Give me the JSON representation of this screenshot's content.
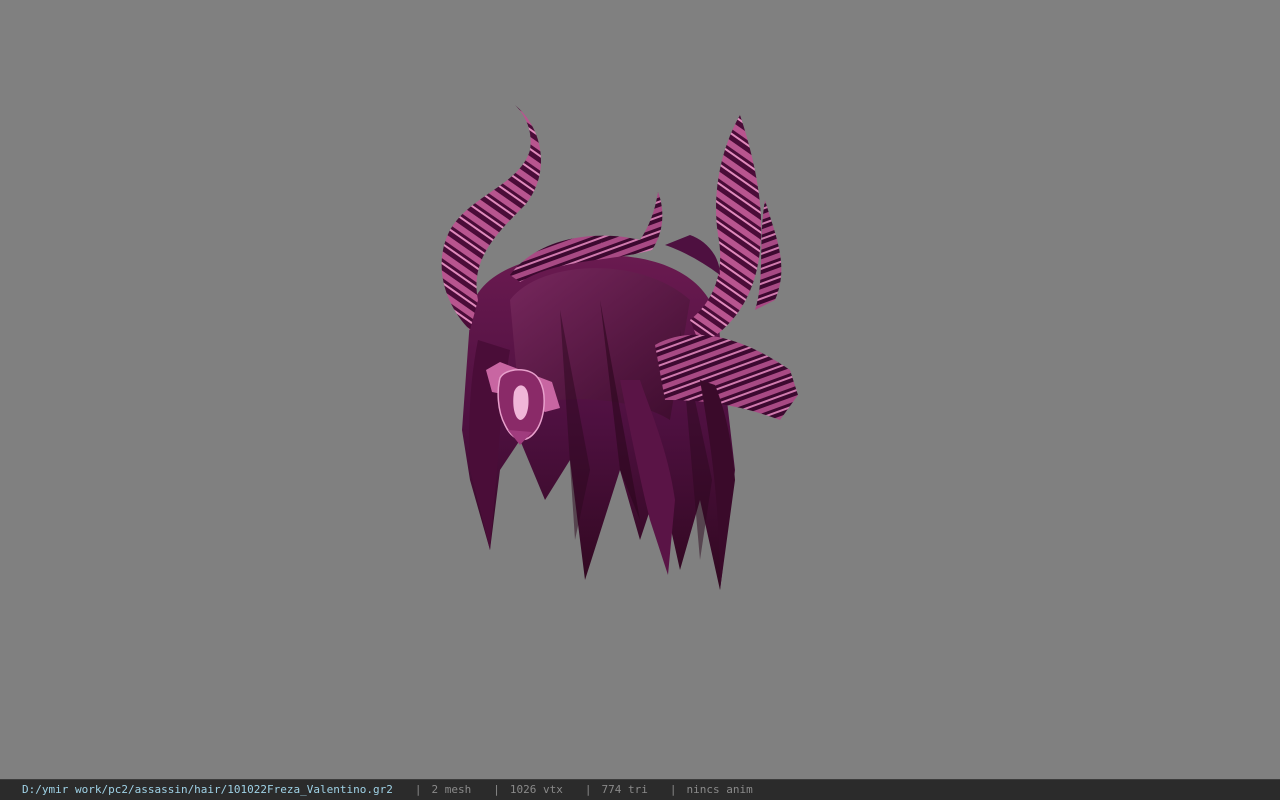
{
  "viewer": {
    "background_color": "#808080",
    "model": {
      "icon": "horned-hair-model",
      "colors": {
        "hair_dark": "#3d0a2c",
        "hair_mid": "#5e1446",
        "hair_light": "#7a2a60",
        "horn_base": "#4a0c38",
        "horn_stripe": "#c0609a",
        "ornament": "#d47ab0"
      }
    }
  },
  "status": {
    "file_path": "D:/ymir work/pc2/assassin/hair/101022Freza_Valentino.gr2",
    "separator": "|",
    "mesh": "2 mesh",
    "vertices": "1026 vtx",
    "triangles": "774 tri",
    "animation": "nincs anim",
    "path_color": "#9fd2e6",
    "stat_color": "#8a8a8a"
  }
}
